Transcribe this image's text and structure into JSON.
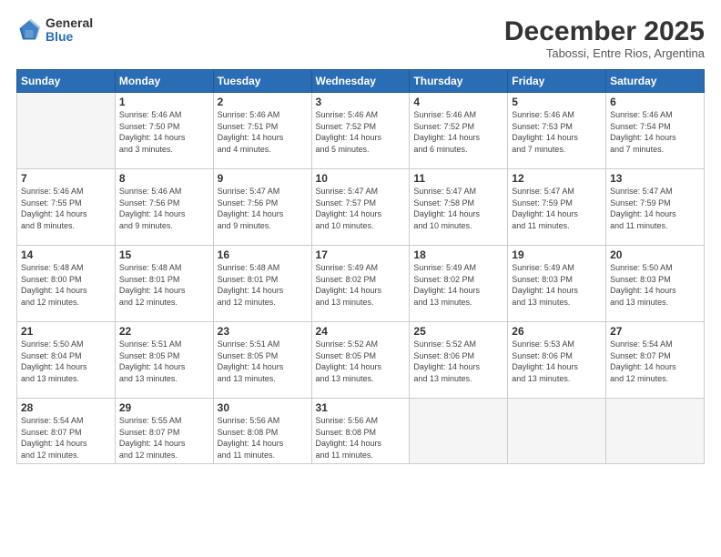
{
  "logo": {
    "general": "General",
    "blue": "Blue"
  },
  "title": "December 2025",
  "subtitle": "Tabossi, Entre Rios, Argentina",
  "header_days": [
    "Sunday",
    "Monday",
    "Tuesday",
    "Wednesday",
    "Thursday",
    "Friday",
    "Saturday"
  ],
  "weeks": [
    [
      {
        "num": "",
        "info": ""
      },
      {
        "num": "1",
        "info": "Sunrise: 5:46 AM\nSunset: 7:50 PM\nDaylight: 14 hours\nand 3 minutes."
      },
      {
        "num": "2",
        "info": "Sunrise: 5:46 AM\nSunset: 7:51 PM\nDaylight: 14 hours\nand 4 minutes."
      },
      {
        "num": "3",
        "info": "Sunrise: 5:46 AM\nSunset: 7:52 PM\nDaylight: 14 hours\nand 5 minutes."
      },
      {
        "num": "4",
        "info": "Sunrise: 5:46 AM\nSunset: 7:52 PM\nDaylight: 14 hours\nand 6 minutes."
      },
      {
        "num": "5",
        "info": "Sunrise: 5:46 AM\nSunset: 7:53 PM\nDaylight: 14 hours\nand 7 minutes."
      },
      {
        "num": "6",
        "info": "Sunrise: 5:46 AM\nSunset: 7:54 PM\nDaylight: 14 hours\nand 7 minutes."
      }
    ],
    [
      {
        "num": "7",
        "info": "Sunrise: 5:46 AM\nSunset: 7:55 PM\nDaylight: 14 hours\nand 8 minutes."
      },
      {
        "num": "8",
        "info": "Sunrise: 5:46 AM\nSunset: 7:56 PM\nDaylight: 14 hours\nand 9 minutes."
      },
      {
        "num": "9",
        "info": "Sunrise: 5:47 AM\nSunset: 7:56 PM\nDaylight: 14 hours\nand 9 minutes."
      },
      {
        "num": "10",
        "info": "Sunrise: 5:47 AM\nSunset: 7:57 PM\nDaylight: 14 hours\nand 10 minutes."
      },
      {
        "num": "11",
        "info": "Sunrise: 5:47 AM\nSunset: 7:58 PM\nDaylight: 14 hours\nand 10 minutes."
      },
      {
        "num": "12",
        "info": "Sunrise: 5:47 AM\nSunset: 7:59 PM\nDaylight: 14 hours\nand 11 minutes."
      },
      {
        "num": "13",
        "info": "Sunrise: 5:47 AM\nSunset: 7:59 PM\nDaylight: 14 hours\nand 11 minutes."
      }
    ],
    [
      {
        "num": "14",
        "info": "Sunrise: 5:48 AM\nSunset: 8:00 PM\nDaylight: 14 hours\nand 12 minutes."
      },
      {
        "num": "15",
        "info": "Sunrise: 5:48 AM\nSunset: 8:01 PM\nDaylight: 14 hours\nand 12 minutes."
      },
      {
        "num": "16",
        "info": "Sunrise: 5:48 AM\nSunset: 8:01 PM\nDaylight: 14 hours\nand 12 minutes."
      },
      {
        "num": "17",
        "info": "Sunrise: 5:49 AM\nSunset: 8:02 PM\nDaylight: 14 hours\nand 13 minutes."
      },
      {
        "num": "18",
        "info": "Sunrise: 5:49 AM\nSunset: 8:02 PM\nDaylight: 14 hours\nand 13 minutes."
      },
      {
        "num": "19",
        "info": "Sunrise: 5:49 AM\nSunset: 8:03 PM\nDaylight: 14 hours\nand 13 minutes."
      },
      {
        "num": "20",
        "info": "Sunrise: 5:50 AM\nSunset: 8:03 PM\nDaylight: 14 hours\nand 13 minutes."
      }
    ],
    [
      {
        "num": "21",
        "info": "Sunrise: 5:50 AM\nSunset: 8:04 PM\nDaylight: 14 hours\nand 13 minutes."
      },
      {
        "num": "22",
        "info": "Sunrise: 5:51 AM\nSunset: 8:05 PM\nDaylight: 14 hours\nand 13 minutes."
      },
      {
        "num": "23",
        "info": "Sunrise: 5:51 AM\nSunset: 8:05 PM\nDaylight: 14 hours\nand 13 minutes."
      },
      {
        "num": "24",
        "info": "Sunrise: 5:52 AM\nSunset: 8:05 PM\nDaylight: 14 hours\nand 13 minutes."
      },
      {
        "num": "25",
        "info": "Sunrise: 5:52 AM\nSunset: 8:06 PM\nDaylight: 14 hours\nand 13 minutes."
      },
      {
        "num": "26",
        "info": "Sunrise: 5:53 AM\nSunset: 8:06 PM\nDaylight: 14 hours\nand 13 minutes."
      },
      {
        "num": "27",
        "info": "Sunrise: 5:54 AM\nSunset: 8:07 PM\nDaylight: 14 hours\nand 12 minutes."
      }
    ],
    [
      {
        "num": "28",
        "info": "Sunrise: 5:54 AM\nSunset: 8:07 PM\nDaylight: 14 hours\nand 12 minutes."
      },
      {
        "num": "29",
        "info": "Sunrise: 5:55 AM\nSunset: 8:07 PM\nDaylight: 14 hours\nand 12 minutes."
      },
      {
        "num": "30",
        "info": "Sunrise: 5:56 AM\nSunset: 8:08 PM\nDaylight: 14 hours\nand 11 minutes."
      },
      {
        "num": "31",
        "info": "Sunrise: 5:56 AM\nSunset: 8:08 PM\nDaylight: 14 hours\nand 11 minutes."
      },
      {
        "num": "",
        "info": ""
      },
      {
        "num": "",
        "info": ""
      },
      {
        "num": "",
        "info": ""
      }
    ]
  ]
}
